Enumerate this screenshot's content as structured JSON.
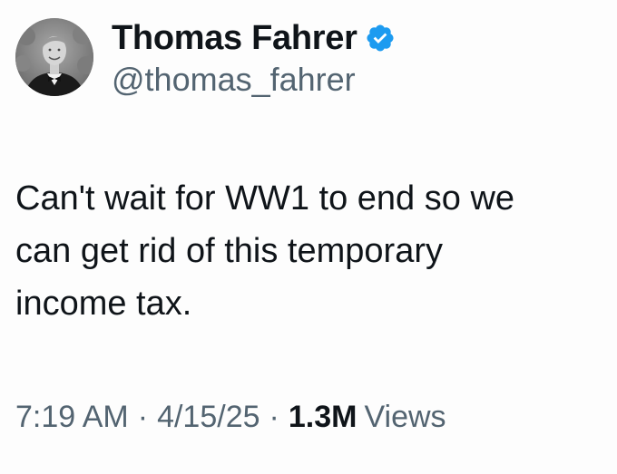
{
  "user": {
    "display_name": "Thomas Fahrer",
    "handle": "@thomas_fahrer",
    "verified": true,
    "verified_color": "#1d9bf0"
  },
  "tweet": {
    "text": "Can't wait for WW1 to end so we\ncan get rid of this temporary\nincome tax."
  },
  "meta": {
    "time": "7:19 AM",
    "separator": "·",
    "date": "4/15/25",
    "views_count": "1.3M",
    "views_label": "Views"
  },
  "colors": {
    "text_primary": "#0f1419",
    "text_secondary": "#536471",
    "background": "#fdfdfd"
  }
}
